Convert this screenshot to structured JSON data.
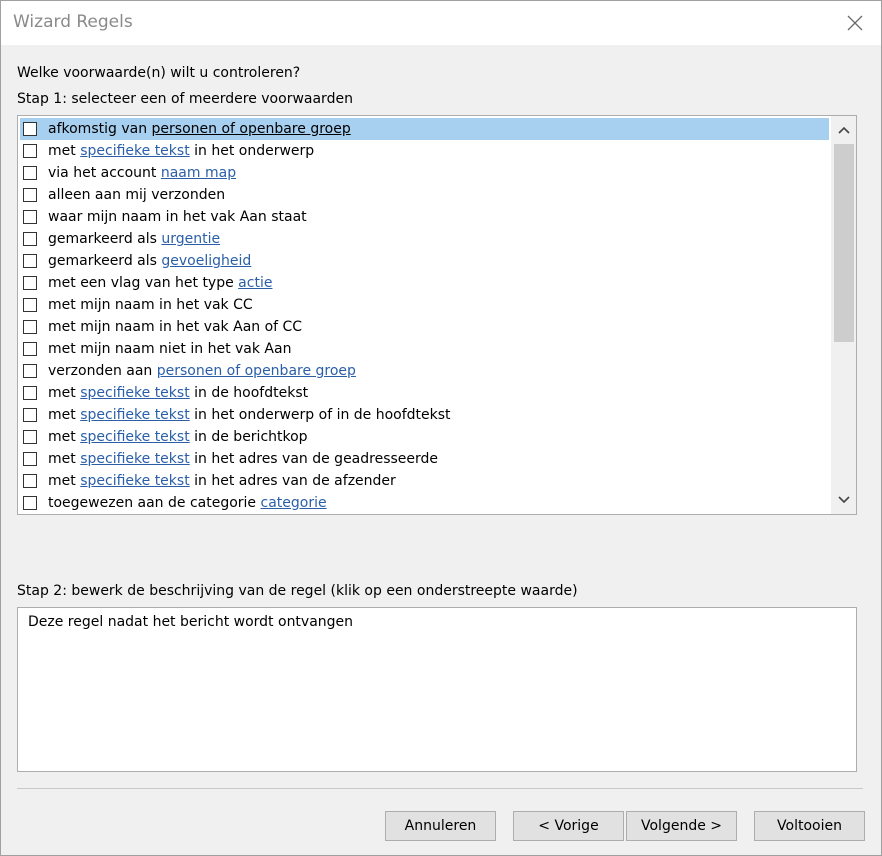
{
  "window": {
    "title": "Wizard Regels"
  },
  "step1": {
    "question": "Welke voorwaarde(n) wilt u controleren?",
    "label": "Stap 1: selecteer een of meerdere voorwaarden",
    "conditions": [
      {
        "parts": [
          "afkomstig van ",
          "personen of openbare groep",
          ""
        ],
        "selected": true
      },
      {
        "parts": [
          "met ",
          "specifieke tekst",
          " in het onderwerp"
        ]
      },
      {
        "parts": [
          "via het account ",
          "naam map",
          ""
        ]
      },
      {
        "parts": [
          "alleen aan mij verzonden",
          "",
          ""
        ]
      },
      {
        "parts": [
          "waar mijn naam in het vak Aan staat",
          "",
          ""
        ]
      },
      {
        "parts": [
          "gemarkeerd als ",
          "urgentie",
          ""
        ]
      },
      {
        "parts": [
          "gemarkeerd als ",
          "gevoeligheid",
          ""
        ]
      },
      {
        "parts": [
          "met een vlag van het type ",
          "actie",
          ""
        ]
      },
      {
        "parts": [
          "met mijn naam in het vak CC",
          "",
          ""
        ]
      },
      {
        "parts": [
          "met mijn naam in het vak Aan of CC",
          "",
          ""
        ]
      },
      {
        "parts": [
          "met mijn naam niet in het vak Aan",
          "",
          ""
        ]
      },
      {
        "parts": [
          "verzonden aan ",
          "personen of openbare groep",
          ""
        ]
      },
      {
        "parts": [
          "met ",
          "specifieke tekst",
          " in de hoofdtekst"
        ]
      },
      {
        "parts": [
          "met ",
          "specifieke tekst",
          " in het onderwerp of in de hoofdtekst"
        ]
      },
      {
        "parts": [
          "met ",
          "specifieke tekst",
          " in de berichtkop"
        ]
      },
      {
        "parts": [
          "met ",
          "specifieke tekst",
          " in het adres van de geadresseerde"
        ]
      },
      {
        "parts": [
          "met ",
          "specifieke tekst",
          " in het adres van de afzender"
        ]
      },
      {
        "parts": [
          "toegewezen aan de categorie ",
          "categorie",
          ""
        ]
      }
    ]
  },
  "step2": {
    "label": "Stap 2: bewerk de beschrijving van de regel (klik op een onderstreepte waarde)",
    "description": "Deze regel nadat het bericht wordt ontvangen"
  },
  "buttons": {
    "cancel": "Annuleren",
    "back": "< Vorige",
    "next": "Volgende >",
    "finish": "Voltooien"
  },
  "colors": {
    "selection": "#a6cff0",
    "link": "#2a5fa8"
  }
}
